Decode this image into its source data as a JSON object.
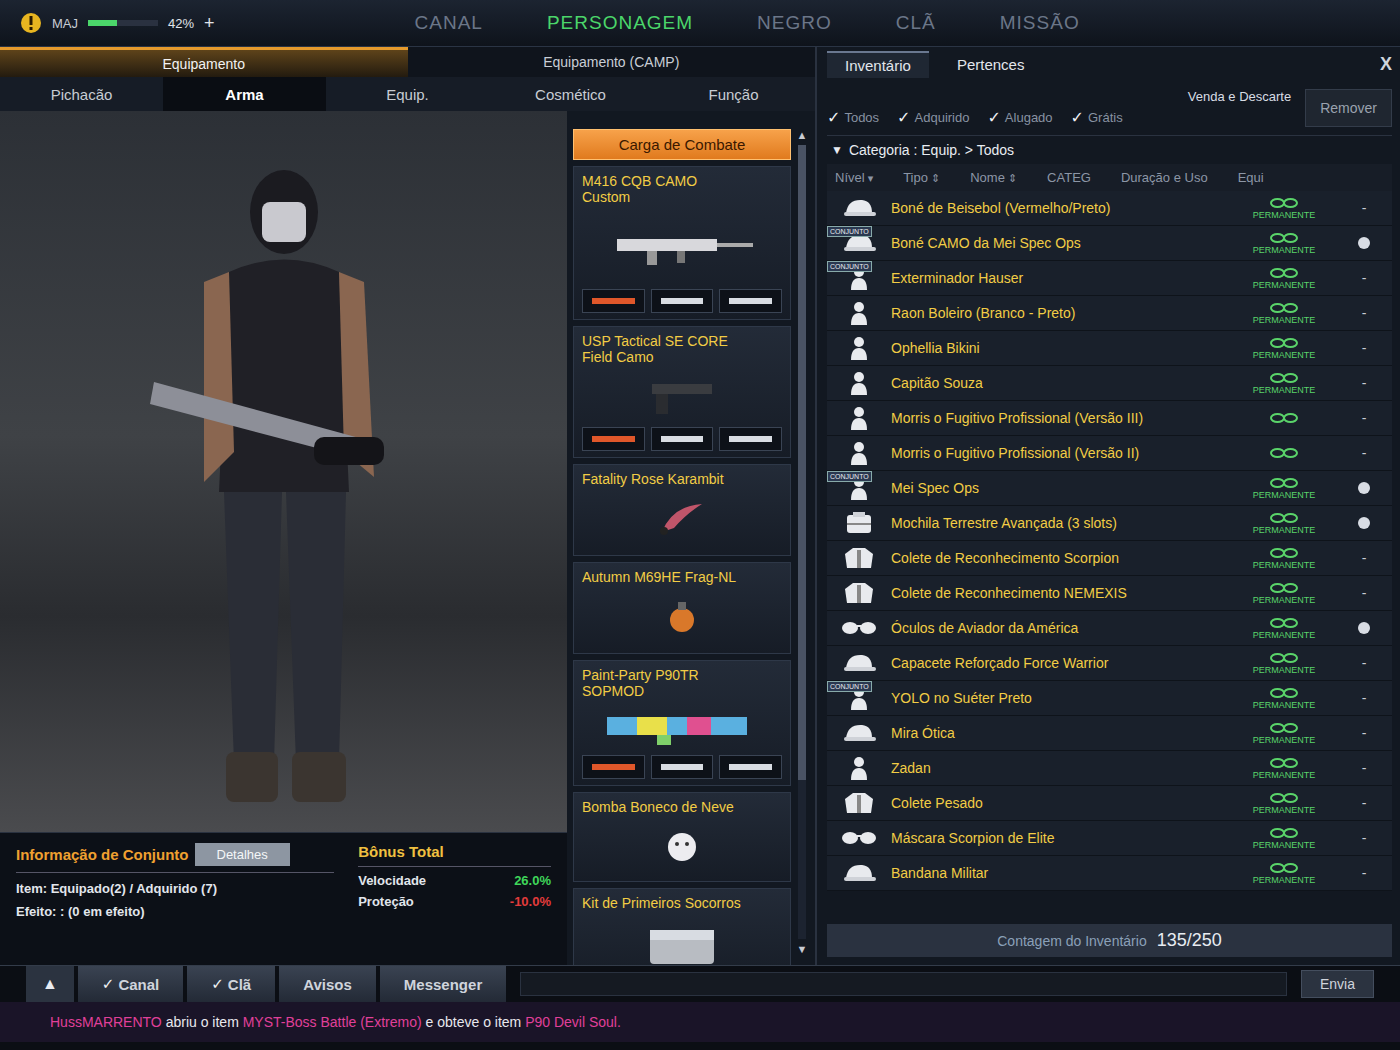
{
  "topbar": {
    "status": "MAJ",
    "percent": "42%",
    "xp_level": 0.42,
    "plus": "+",
    "menus": [
      {
        "label": "CANAL",
        "selected": false
      },
      {
        "label": "PERSONAGEM",
        "selected": true
      },
      {
        "label": "NEGRO",
        "selected": false
      },
      {
        "label": "CLÃ",
        "selected": false
      },
      {
        "label": "MISSÃO",
        "selected": false
      }
    ]
  },
  "equipment": {
    "tabs": [
      {
        "label": "Equipamento",
        "selected": true
      },
      {
        "label": "Equipamento (CAMP)",
        "selected": false
      }
    ],
    "subtabs": [
      {
        "label": "Pichacão",
        "selected": false
      },
      {
        "label": "Arma",
        "selected": true
      },
      {
        "label": "Equip.",
        "selected": false
      },
      {
        "label": "Cosmético",
        "selected": false
      },
      {
        "label": "Função",
        "selected": false
      }
    ]
  },
  "loadout": {
    "title": "Carga de Combate",
    "scroll_up": "▲",
    "scroll_down": "▼",
    "items": [
      {
        "name": "M416 CQB CAMO",
        "subtitle": "Custom",
        "kind": "rifle"
      },
      {
        "name": "USP Tactical SE CORE",
        "subtitle": "Field Camo",
        "kind": "pistol"
      },
      {
        "name": "Fatality Rose Karambit",
        "subtitle": "",
        "kind": "knife"
      },
      {
        "name": "Autumn M69HE Frag-NL",
        "subtitle": "",
        "kind": "grenade"
      },
      {
        "name": "Paint-Party P90TR",
        "subtitle": "SOPMOD",
        "kind": "smg"
      },
      {
        "name": "Bomba Boneco de Neve",
        "subtitle": "",
        "kind": "bomb"
      },
      {
        "name": "Kit de Primeiros Socorros",
        "subtitle": "",
        "kind": "kit"
      }
    ]
  },
  "set_info": {
    "title": "Informação de Conjunto",
    "details_button": "Detalhes",
    "items": "Item: Equipado(2) / Adquirido (7)",
    "effect": "Efeito: : (0 em efeito)"
  },
  "bonus": {
    "title": "Bônus Total",
    "stats": [
      {
        "label": "Velocidade",
        "value": "26.0%",
        "color": "#3fd65a"
      },
      {
        "label": "Proteção",
        "value": "-10.0%",
        "color": "#e33b3b"
      }
    ]
  },
  "inventory": {
    "tabs": [
      {
        "label": "Inventário",
        "selected": true
      },
      {
        "label": "Pertences",
        "selected": false
      }
    ],
    "sell_label": "Venda e Descarte",
    "remove_button": "Remover",
    "close": "X",
    "check": "✓",
    "filters": [
      {
        "label": "Todos",
        "checked": true
      },
      {
        "label": "Adquirido",
        "checked": true
      },
      {
        "label": "Alugado",
        "checked": true
      },
      {
        "label": "Grátis",
        "checked": true
      }
    ],
    "category_arrow": "▼",
    "category": "Categoria : Equip. > Todos",
    "columns": [
      {
        "label": "Nível",
        "sort": "▾"
      },
      {
        "label": "Tipo",
        "sort": "⇕"
      },
      {
        "label": "Nome",
        "sort": "⇕"
      },
      {
        "label": "CATEG",
        "sort": ""
      },
      {
        "label": "Duração e Uso",
        "sort": ""
      },
      {
        "label": "Equi",
        "sort": ""
      }
    ],
    "set_badge": "CONJUNTO",
    "dash": "-",
    "rows": [
      {
        "kind": "cap",
        "name": "Boné de Beisebol (Vermelho/Preto)",
        "set": false,
        "duration": "PERMANENTE",
        "equipped": false
      },
      {
        "kind": "cap",
        "name": "Boné CAMO da Mei Spec Ops",
        "set": true,
        "duration": "PERMANENTE",
        "equipped": true
      },
      {
        "kind": "char",
        "name": "Exterminador Hauser",
        "set": true,
        "duration": "PERMANENTE",
        "equipped": false
      },
      {
        "kind": "char",
        "name": "Raon Boleiro (Branco - Preto)",
        "set": false,
        "duration": "PERMANENTE",
        "equipped": false
      },
      {
        "kind": "char",
        "name": "Ophellia Bikini",
        "set": false,
        "duration": "PERMANENTE",
        "equipped": false
      },
      {
        "kind": "char",
        "name": "Capitão Souza",
        "set": false,
        "duration": "PERMANENTE",
        "equipped": false
      },
      {
        "kind": "char",
        "name": "Morris o Fugitivo Profissional (Versão III)",
        "set": false,
        "duration": "",
        "equipped": false
      },
      {
        "kind": "char",
        "name": "Morris o Fugitivo Profissional (Versão II)",
        "set": false,
        "duration": "",
        "equipped": false
      },
      {
        "kind": "char",
        "name": "Mei Spec Ops",
        "set": true,
        "duration": "PERMANENTE",
        "equipped": true
      },
      {
        "kind": "bag",
        "name": "Mochila Terrestre Avançada (3 slots)",
        "set": false,
        "duration": "PERMANENTE",
        "equipped": true
      },
      {
        "kind": "vest",
        "name": "Colete de Reconhecimento Scorpion",
        "set": false,
        "duration": "PERMANENTE",
        "equipped": false
      },
      {
        "kind": "vest",
        "name": "Colete de Reconhecimento NEMEXIS",
        "set": false,
        "duration": "PERMANENTE",
        "equipped": false
      },
      {
        "kind": "glasses",
        "name": "Óculos de Aviador da América",
        "set": false,
        "duration": "PERMANENTE",
        "equipped": true
      },
      {
        "kind": "cap",
        "name": "Capacete Reforçado Force Warrior",
        "set": false,
        "duration": "PERMANENTE",
        "equipped": false
      },
      {
        "kind": "char",
        "name": "YOLO no Suéter Preto",
        "set": true,
        "duration": "PERMANENTE",
        "equipped": false
      },
      {
        "kind": "cap",
        "name": "Mira Ótica",
        "set": false,
        "duration": "PERMANENTE",
        "equipped": false
      },
      {
        "kind": "char",
        "name": "Zadan",
        "set": false,
        "duration": "PERMANENTE",
        "equipped": false
      },
      {
        "kind": "vest",
        "name": "Colete Pesado",
        "set": false,
        "duration": "PERMANENTE",
        "equipped": false
      },
      {
        "kind": "glasses",
        "name": "Máscara Scorpion de Elite",
        "set": false,
        "duration": "PERMANENTE",
        "equipped": false
      },
      {
        "kind": "cap",
        "name": "Bandana Militar",
        "set": false,
        "duration": "PERMANENTE",
        "equipped": false
      }
    ],
    "count_label": "Contagem do Inventário",
    "count": "135/250"
  },
  "chat": {
    "collapse": "▲",
    "check": "✓",
    "tabs": [
      {
        "label": "Canal",
        "checked": true
      },
      {
        "label": "Clã",
        "checked": true
      },
      {
        "label": "Avisos",
        "checked": false
      },
      {
        "label": "Messenger",
        "checked": false
      }
    ],
    "send": "Envia",
    "message": [
      {
        "text": "HussMARRENTO",
        "color": "#e0409a"
      },
      {
        "text": " abriu o item ",
        "color": "#e8e8ee"
      },
      {
        "text": "MYST-Boss Battle (Extremo)",
        "color": "#e0409a"
      },
      {
        "text": " e obteve o item ",
        "color": "#e8e8ee"
      },
      {
        "text": "P90 Devil Soul.",
        "color": "#e0409a"
      }
    ]
  }
}
